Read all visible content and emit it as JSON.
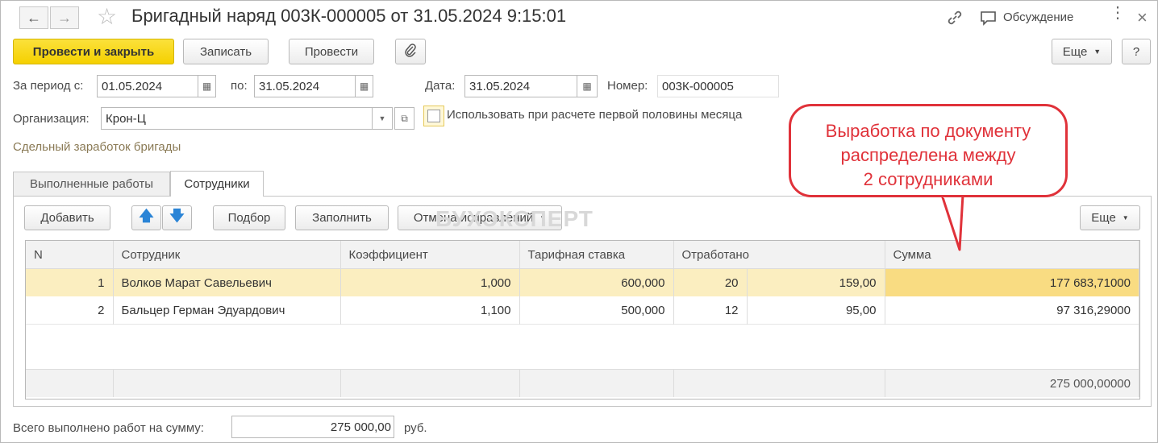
{
  "window": {
    "title": "Бригадный наряд 003К-000005 от 31.05.2024 9:15:01",
    "discussion_label": "Обсуждение"
  },
  "toolbar": {
    "post_close": "Провести и закрыть",
    "save": "Записать",
    "post": "Провести",
    "more": "Еще",
    "help": "?"
  },
  "form": {
    "period_from_label": "За период с:",
    "period_from": "01.05.2024",
    "period_to_label": "по:",
    "period_to": "31.05.2024",
    "date_label": "Дата:",
    "date": "31.05.2024",
    "number_label": "Номер:",
    "number": "003К-000005",
    "org_label": "Организация:",
    "org": "Крон-Ц",
    "checkbox_label": "Использовать при расчете первой половины месяца",
    "piecework_link": "Сдельный заработок бригады"
  },
  "tabs": [
    "Выполненные работы",
    "Сотрудники"
  ],
  "table_toolbar": {
    "add": "Добавить",
    "pick": "Подбор",
    "fill": "Заполнить",
    "cancel_fix": "Отмена исправлений",
    "more": "Еще"
  },
  "watermark": "БУХЭКСПЕРТ",
  "table": {
    "headers": [
      "N",
      "Сотрудник",
      "Коэффициент",
      "Тарифная ставка",
      "Отработано",
      "Сумма"
    ],
    "rows": [
      {
        "n": "1",
        "employee": "Волков Марат Савельевич",
        "coef": "1,000",
        "rate": "600,000",
        "worked_days": "20",
        "worked_hours": "159,00",
        "sum": "177 683,71000"
      },
      {
        "n": "2",
        "employee": "Бальцер Герман Эдуардович",
        "coef": "1,100",
        "rate": "500,000",
        "worked_days": "12",
        "worked_hours": "95,00",
        "sum": "97 316,29000"
      }
    ],
    "total_sum": "275 000,00000"
  },
  "total": {
    "label": "Всего выполнено работ на сумму:",
    "value": "275 000,00",
    "currency": "руб."
  },
  "callout": {
    "line1": "Выработка по документу",
    "line2": "распределена между",
    "line3": "2 сотрудниками"
  },
  "colors": {
    "primary_button": "#f5d000",
    "selected_row": "#fbeec0",
    "callout": "#e0323a"
  }
}
